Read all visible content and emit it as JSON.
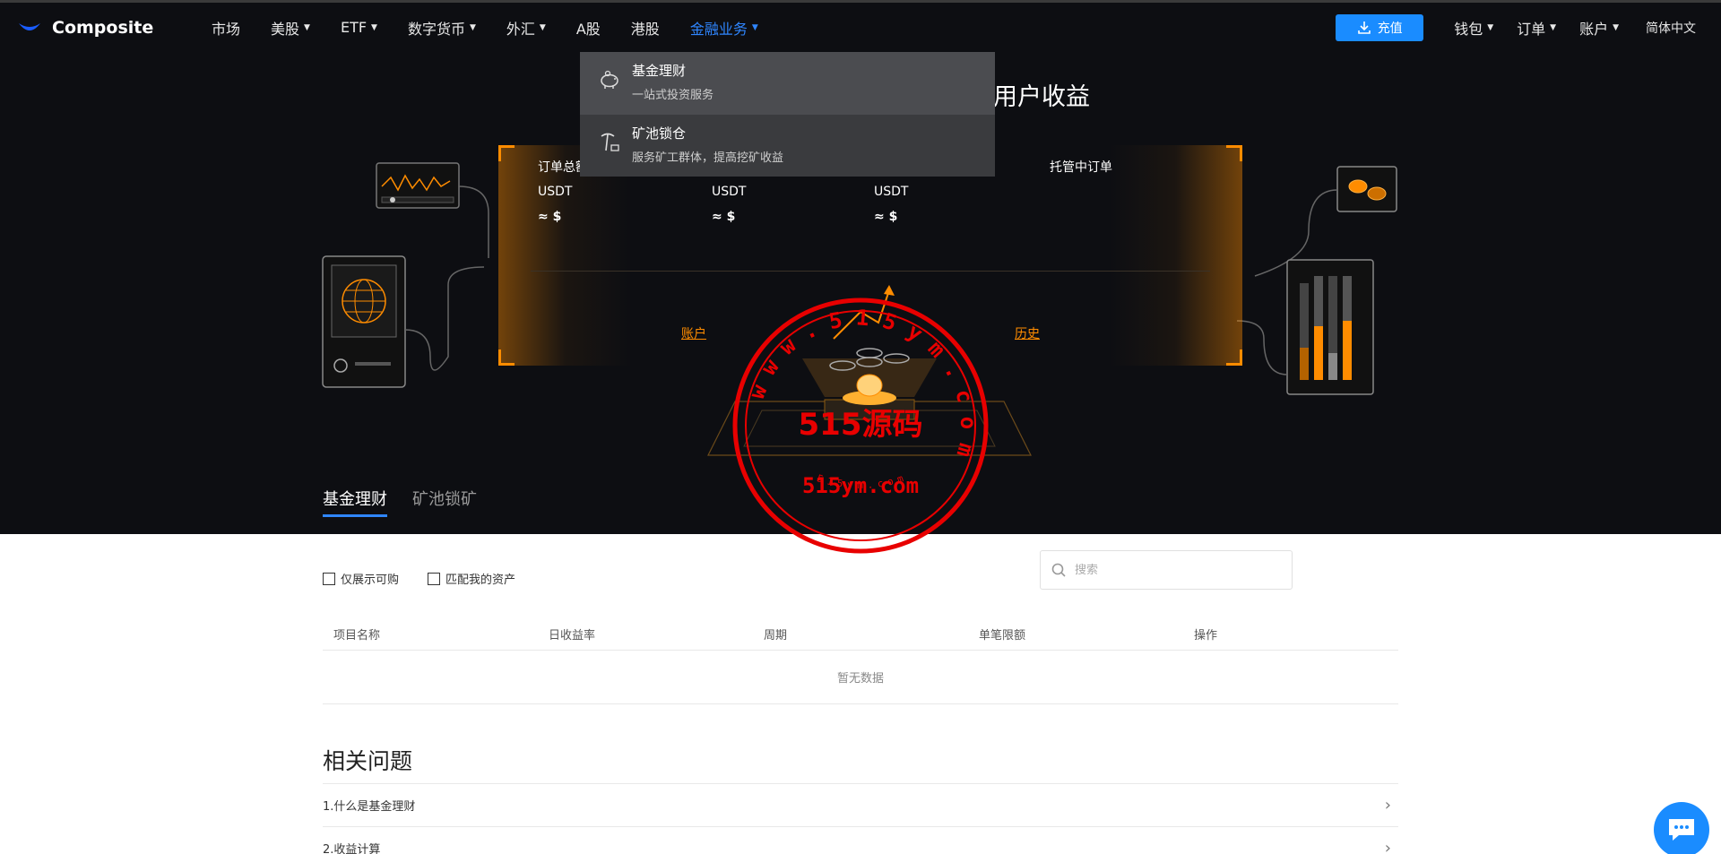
{
  "brand": {
    "name": "Composite",
    "accent": "#1a8cff",
    "highlight": "#ff8c00"
  },
  "nav": {
    "items": [
      {
        "label": "市场",
        "caret": false
      },
      {
        "label": "美股",
        "caret": true
      },
      {
        "label": "ETF",
        "caret": true
      },
      {
        "label": "数字货币",
        "caret": true
      },
      {
        "label": "外汇",
        "caret": true
      },
      {
        "label": "A股",
        "caret": false
      },
      {
        "label": "港股",
        "caret": false
      },
      {
        "label": "金融业务",
        "caret": true,
        "active": true
      }
    ],
    "deposit_label": "充值",
    "wallet_label": "钱包",
    "orders_label": "订单",
    "account_label": "账户",
    "language_label": "简体中文"
  },
  "dropdown": {
    "items": [
      {
        "title": "基金理财",
        "subtitle": "一站式投资服务",
        "icon": "piggy-bank-icon"
      },
      {
        "title": "矿池锁仓",
        "subtitle": "服务矿工群体，提高挖矿收益",
        "icon": "mining-pickaxe-icon"
      }
    ]
  },
  "hero": {
    "title": "用户收益",
    "stats": [
      {
        "label": "订单总额",
        "unit": "USDT",
        "value": "≈ $"
      },
      {
        "label": "",
        "unit": "USDT",
        "value": "≈ $"
      },
      {
        "label": "",
        "unit": "USDT",
        "value": "≈ $"
      },
      {
        "label": "托管中订单",
        "unit": "",
        "value": ""
      }
    ],
    "account_link": "账户",
    "history_link": "历史",
    "tabs": [
      "基金理财",
      "矿池锁矿"
    ]
  },
  "watermark": {
    "brand": "515源码",
    "domain": "515ym.com",
    "ring_text": "www.515ym.com",
    "small_text": "515ym.com"
  },
  "filters": {
    "only_available": "仅展示可购",
    "match_assets": "匹配我的资产",
    "search_placeholder": "搜索"
  },
  "table": {
    "columns": [
      "项目名称",
      "日收益率",
      "周期",
      "单笔限额",
      "操作"
    ],
    "empty_text": "暂无数据"
  },
  "faq": {
    "title": "相关问题",
    "items": [
      "1.什么是基金理财",
      "2.收益计算"
    ]
  }
}
